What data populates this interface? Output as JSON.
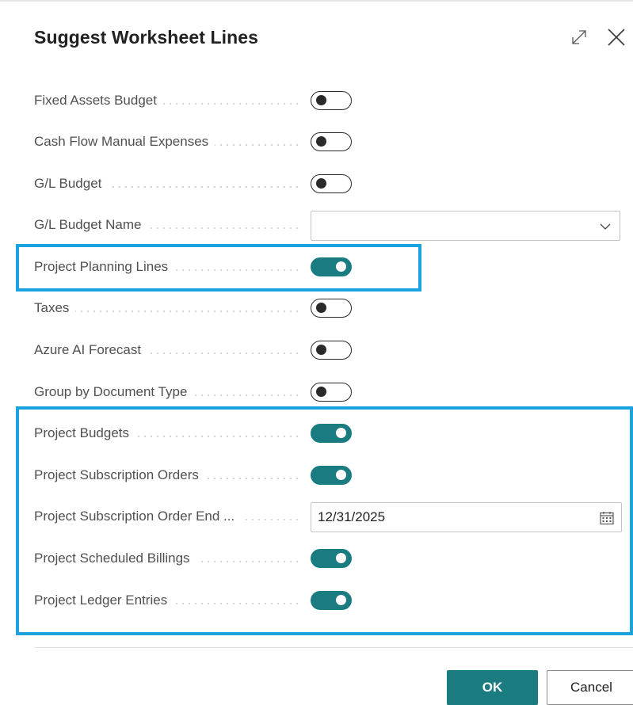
{
  "dialog": {
    "title": "Suggest Worksheet Lines"
  },
  "fields": {
    "fixed_assets_budget": {
      "label": "Fixed Assets Budget",
      "value": false
    },
    "cash_flow_manual_expenses": {
      "label": "Cash Flow Manual Expenses",
      "value": false
    },
    "gl_budget": {
      "label": "G/L Budget",
      "value": false
    },
    "gl_budget_name": {
      "label": "G/L Budget Name",
      "value": ""
    },
    "project_planning_lines": {
      "label": "Project Planning Lines",
      "value": true
    },
    "taxes": {
      "label": "Taxes",
      "value": false
    },
    "azure_ai_forecast": {
      "label": "Azure AI Forecast",
      "value": false
    },
    "group_by_document_type": {
      "label": "Group by Document Type",
      "value": false
    },
    "project_budgets": {
      "label": "Project Budgets",
      "value": true
    },
    "project_subscription_orders": {
      "label": "Project Subscription Orders",
      "value": true
    },
    "project_subscription_order_end": {
      "label": "Project Subscription Order End ...",
      "value": "12/31/2025"
    },
    "project_scheduled_billings": {
      "label": "Project Scheduled Billings",
      "value": true
    },
    "project_ledger_entries": {
      "label": "Project Ledger Entries",
      "value": true
    }
  },
  "footer": {
    "ok_label": "OK",
    "cancel_label": "Cancel"
  },
  "icons": {
    "expand": "expand-icon",
    "close": "close-icon",
    "dropdown": "chevron-down-icon",
    "calendar": "calendar-icon"
  },
  "colors": {
    "accent": "#1a7c80",
    "highlight": "#1aa3e0",
    "label": "#505050"
  }
}
